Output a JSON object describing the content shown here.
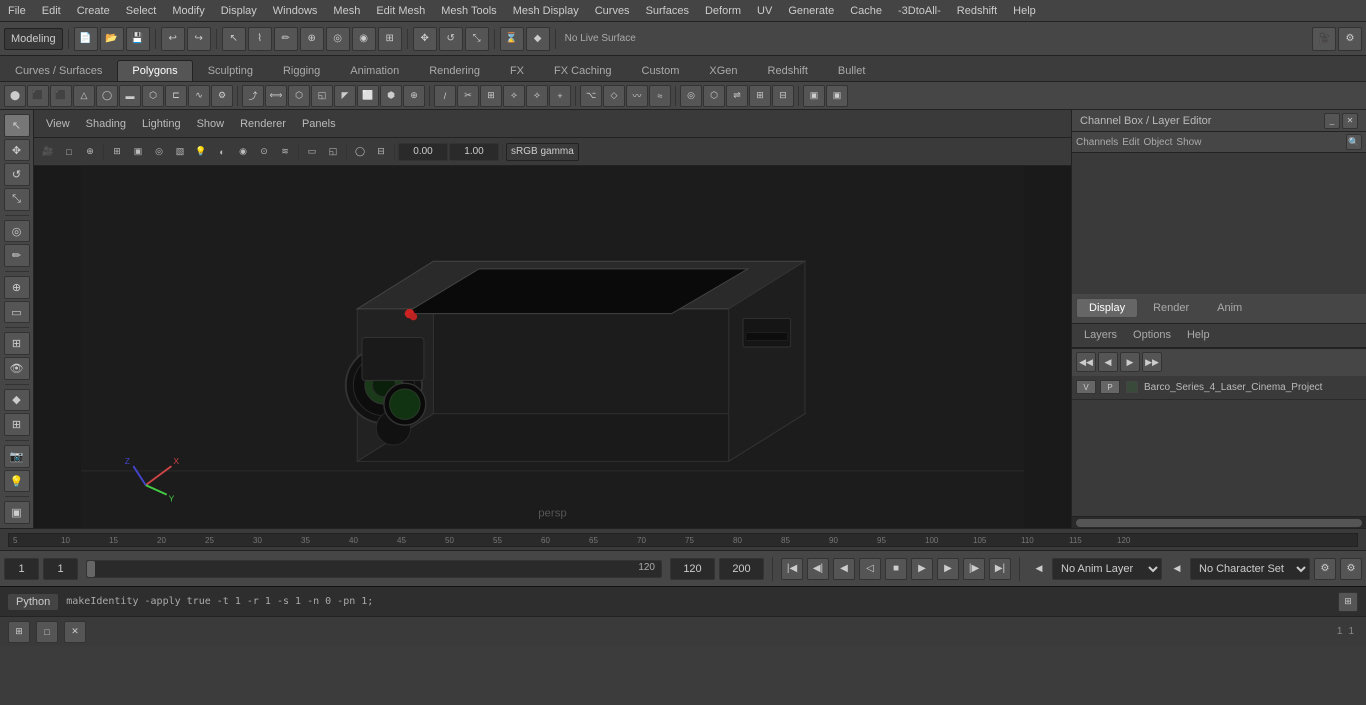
{
  "menubar": {
    "items": [
      "File",
      "Edit",
      "Create",
      "Select",
      "Modify",
      "Display",
      "Windows",
      "Mesh",
      "Edit Mesh",
      "Mesh Tools",
      "Mesh Display",
      "Curves",
      "Surfaces",
      "Deform",
      "UV",
      "Generate",
      "Cache",
      "-3DtoAll-",
      "Redshift",
      "Help"
    ]
  },
  "toolbar1": {
    "workspace_label": "Modeling",
    "no_live_surface": "No Live Surface",
    "gamma": "sRGB gamma"
  },
  "tabs": {
    "items": [
      "Curves / Surfaces",
      "Polygons",
      "Sculpting",
      "Rigging",
      "Animation",
      "Rendering",
      "FX",
      "FX Caching",
      "Custom",
      "XGen",
      "Redshift",
      "Bullet"
    ],
    "active": "Polygons"
  },
  "viewport": {
    "menu_items": [
      "View",
      "Shading",
      "Lighting",
      "Show",
      "Renderer",
      "Panels"
    ],
    "persp_label": "persp",
    "gamma_value": "0.00",
    "gamma_mult": "1.00"
  },
  "right_panel": {
    "title": "Channel Box / Layer Editor",
    "tabs": [
      "Display",
      "Render",
      "Anim"
    ],
    "active_tab": "Display",
    "sub_tabs": [
      "Channels",
      "Edit",
      "Object",
      "Show"
    ],
    "layers_label": "Layers",
    "options_label": "Options",
    "help_label": "Help",
    "layer_item": {
      "v_label": "V",
      "p_label": "P",
      "layer_name": "Barco_Series_4_Laser_Cinema_Project"
    }
  },
  "timeline": {
    "ticks": [
      "5",
      "10",
      "15",
      "20",
      "25",
      "30",
      "35",
      "40",
      "45",
      "50",
      "55",
      "60",
      "65",
      "70",
      "75",
      "80",
      "85",
      "90",
      "95",
      "100",
      "105",
      "110",
      "115",
      "120"
    ]
  },
  "playback": {
    "current_frame": "1",
    "start_frame": "1",
    "end_frame_input": "120",
    "range_start": "1",
    "range_end": "120",
    "range_end2": "200",
    "anim_layer": "No Anim Layer",
    "char_set": "No Character Set",
    "frame_indicator": "1"
  },
  "python_bar": {
    "label": "Python",
    "command": "makeIdentity -apply true -t 1 -r 1 -s 1 -n 0 -pn 1;"
  },
  "status_bar": {
    "items": [
      "1",
      "1"
    ]
  },
  "colors": {
    "accent": "#4a90d9",
    "bg_dark": "#2a2a2a",
    "bg_mid": "#3c3c3c",
    "bg_light": "#464646",
    "border": "#222222",
    "text": "#cccccc",
    "text_dim": "#999999"
  },
  "icons": {
    "select": "↖",
    "move": "✥",
    "rotate": "↺",
    "scale": "⤡",
    "rect_select": "▭",
    "lasso": "⌇",
    "plus_minus": "⊞",
    "paint": "✏",
    "snap": "⊕",
    "soft": "◉",
    "arrow_left": "◀",
    "arrow_right": "▶",
    "play": "▶",
    "stop": "■",
    "prev": "◀◀",
    "next": "▶▶",
    "prev_key": "◀|",
    "next_key": "|▶",
    "first": "|◀",
    "last": "▶|"
  }
}
